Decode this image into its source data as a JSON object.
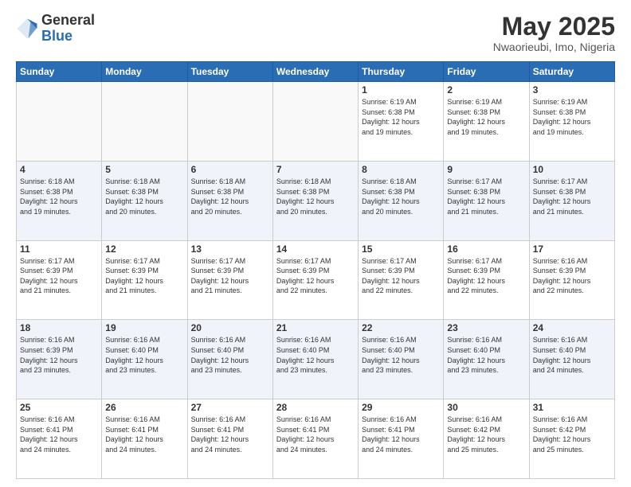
{
  "header": {
    "logo_general": "General",
    "logo_blue": "Blue",
    "month_title": "May 2025",
    "location": "Nwaorieubi, Imo, Nigeria"
  },
  "days_of_week": [
    "Sunday",
    "Monday",
    "Tuesday",
    "Wednesday",
    "Thursday",
    "Friday",
    "Saturday"
  ],
  "weeks": [
    [
      {
        "day": "",
        "info": ""
      },
      {
        "day": "",
        "info": ""
      },
      {
        "day": "",
        "info": ""
      },
      {
        "day": "",
        "info": ""
      },
      {
        "day": "1",
        "info": "Sunrise: 6:19 AM\nSunset: 6:38 PM\nDaylight: 12 hours\nand 19 minutes."
      },
      {
        "day": "2",
        "info": "Sunrise: 6:19 AM\nSunset: 6:38 PM\nDaylight: 12 hours\nand 19 minutes."
      },
      {
        "day": "3",
        "info": "Sunrise: 6:19 AM\nSunset: 6:38 PM\nDaylight: 12 hours\nand 19 minutes."
      }
    ],
    [
      {
        "day": "4",
        "info": "Sunrise: 6:18 AM\nSunset: 6:38 PM\nDaylight: 12 hours\nand 19 minutes."
      },
      {
        "day": "5",
        "info": "Sunrise: 6:18 AM\nSunset: 6:38 PM\nDaylight: 12 hours\nand 20 minutes."
      },
      {
        "day": "6",
        "info": "Sunrise: 6:18 AM\nSunset: 6:38 PM\nDaylight: 12 hours\nand 20 minutes."
      },
      {
        "day": "7",
        "info": "Sunrise: 6:18 AM\nSunset: 6:38 PM\nDaylight: 12 hours\nand 20 minutes."
      },
      {
        "day": "8",
        "info": "Sunrise: 6:18 AM\nSunset: 6:38 PM\nDaylight: 12 hours\nand 20 minutes."
      },
      {
        "day": "9",
        "info": "Sunrise: 6:17 AM\nSunset: 6:38 PM\nDaylight: 12 hours\nand 21 minutes."
      },
      {
        "day": "10",
        "info": "Sunrise: 6:17 AM\nSunset: 6:38 PM\nDaylight: 12 hours\nand 21 minutes."
      }
    ],
    [
      {
        "day": "11",
        "info": "Sunrise: 6:17 AM\nSunset: 6:39 PM\nDaylight: 12 hours\nand 21 minutes."
      },
      {
        "day": "12",
        "info": "Sunrise: 6:17 AM\nSunset: 6:39 PM\nDaylight: 12 hours\nand 21 minutes."
      },
      {
        "day": "13",
        "info": "Sunrise: 6:17 AM\nSunset: 6:39 PM\nDaylight: 12 hours\nand 21 minutes."
      },
      {
        "day": "14",
        "info": "Sunrise: 6:17 AM\nSunset: 6:39 PM\nDaylight: 12 hours\nand 22 minutes."
      },
      {
        "day": "15",
        "info": "Sunrise: 6:17 AM\nSunset: 6:39 PM\nDaylight: 12 hours\nand 22 minutes."
      },
      {
        "day": "16",
        "info": "Sunrise: 6:17 AM\nSunset: 6:39 PM\nDaylight: 12 hours\nand 22 minutes."
      },
      {
        "day": "17",
        "info": "Sunrise: 6:16 AM\nSunset: 6:39 PM\nDaylight: 12 hours\nand 22 minutes."
      }
    ],
    [
      {
        "day": "18",
        "info": "Sunrise: 6:16 AM\nSunset: 6:39 PM\nDaylight: 12 hours\nand 23 minutes."
      },
      {
        "day": "19",
        "info": "Sunrise: 6:16 AM\nSunset: 6:40 PM\nDaylight: 12 hours\nand 23 minutes."
      },
      {
        "day": "20",
        "info": "Sunrise: 6:16 AM\nSunset: 6:40 PM\nDaylight: 12 hours\nand 23 minutes."
      },
      {
        "day": "21",
        "info": "Sunrise: 6:16 AM\nSunset: 6:40 PM\nDaylight: 12 hours\nand 23 minutes."
      },
      {
        "day": "22",
        "info": "Sunrise: 6:16 AM\nSunset: 6:40 PM\nDaylight: 12 hours\nand 23 minutes."
      },
      {
        "day": "23",
        "info": "Sunrise: 6:16 AM\nSunset: 6:40 PM\nDaylight: 12 hours\nand 23 minutes."
      },
      {
        "day": "24",
        "info": "Sunrise: 6:16 AM\nSunset: 6:40 PM\nDaylight: 12 hours\nand 24 minutes."
      }
    ],
    [
      {
        "day": "25",
        "info": "Sunrise: 6:16 AM\nSunset: 6:41 PM\nDaylight: 12 hours\nand 24 minutes."
      },
      {
        "day": "26",
        "info": "Sunrise: 6:16 AM\nSunset: 6:41 PM\nDaylight: 12 hours\nand 24 minutes."
      },
      {
        "day": "27",
        "info": "Sunrise: 6:16 AM\nSunset: 6:41 PM\nDaylight: 12 hours\nand 24 minutes."
      },
      {
        "day": "28",
        "info": "Sunrise: 6:16 AM\nSunset: 6:41 PM\nDaylight: 12 hours\nand 24 minutes."
      },
      {
        "day": "29",
        "info": "Sunrise: 6:16 AM\nSunset: 6:41 PM\nDaylight: 12 hours\nand 24 minutes."
      },
      {
        "day": "30",
        "info": "Sunrise: 6:16 AM\nSunset: 6:42 PM\nDaylight: 12 hours\nand 25 minutes."
      },
      {
        "day": "31",
        "info": "Sunrise: 6:16 AM\nSunset: 6:42 PM\nDaylight: 12 hours\nand 25 minutes."
      }
    ]
  ]
}
